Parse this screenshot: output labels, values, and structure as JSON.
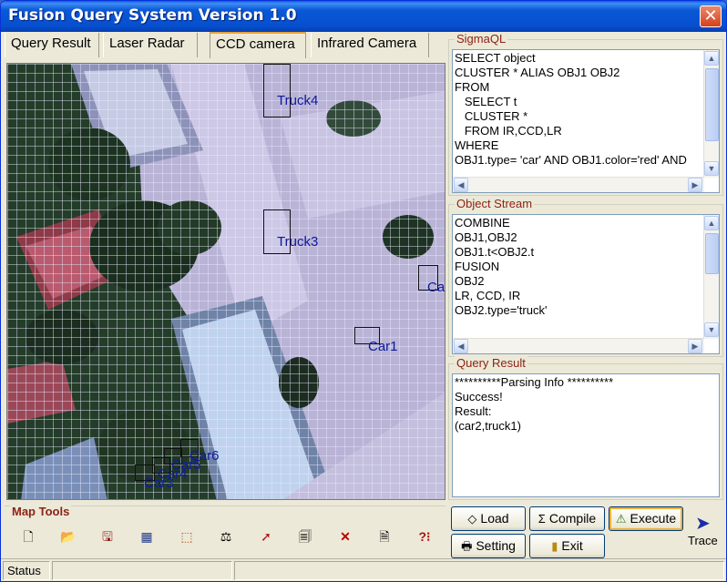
{
  "window": {
    "title": "Fusion Query System Version 1.0",
    "close_glyph": "✕"
  },
  "tabs": [
    {
      "label": "Query Result"
    },
    {
      "label": "Laser Radar"
    },
    {
      "label": "CCD camera"
    },
    {
      "label": "Infrared Camera"
    }
  ],
  "active_tab": "CCD camera",
  "map": {
    "labels": {
      "truck4": "Truck4",
      "truck3": "Truck3",
      "car1": "Car1",
      "car2": "Ca",
      "car6": "Car6",
      "car5": "Car5",
      "car4": "Car4",
      "car3": "Car3"
    }
  },
  "sigmaql": {
    "label": "SigmaQL",
    "lines": [
      "SELECT object",
      "CLUSTER * ALIAS OBJ1 OBJ2",
      "FROM",
      "   SELECT t",
      "   CLUSTER *",
      "   FROM IR,CCD,LR",
      "WHERE",
      "OBJ1.type= 'car' AND OBJ1.color='red' AND"
    ]
  },
  "object_stream": {
    "label": "Object Stream",
    "lines": [
      "COMBINE",
      "OBJ1,OBJ2",
      "OBJ1.t<OBJ2.t",
      "",
      "FUSION",
      "OBJ2",
      "LR, CCD, IR",
      "OBJ2.type='truck'"
    ]
  },
  "query_result": {
    "label": "Query Result",
    "lines": [
      "**********Parsing Info **********",
      "Success!",
      "",
      "Result:",
      "(car2,truck1)"
    ]
  },
  "map_tools": {
    "label": "Map Tools",
    "icons": [
      "new-icon",
      "open-icon",
      "save-icon",
      "table-icon",
      "select-area-icon",
      "measure-icon",
      "pointer-icon",
      "export-icon",
      "delete-icon",
      "document-icon",
      "help-icon"
    ]
  },
  "buttons": {
    "load": "Load",
    "compile": "Compile",
    "execute": "Execute",
    "setting": "Setting",
    "exit": "Exit",
    "trace": "Trace"
  },
  "status": {
    "text": "Status"
  },
  "colors": {
    "titlebar": "#0a58d6",
    "group_label": "#8c2316",
    "map_label": "#0d1a9a"
  }
}
